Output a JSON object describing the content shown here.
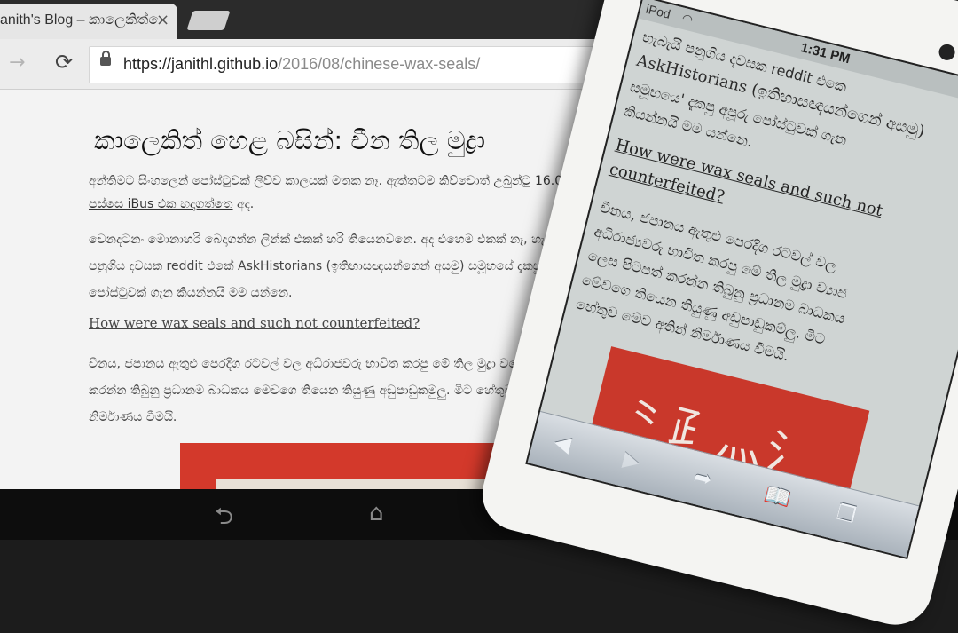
{
  "browser": {
    "tab_title": "anith's Blog – කාලෙකිත් ෙ",
    "tab_close": "×",
    "url_host": "https://janithl.github.io",
    "url_path": "/2016/08/chinese-wax-seals/",
    "forward_glyph": "→",
    "reload_glyph": "⟳"
  },
  "article": {
    "title": "කාලෙකිත් හෙළ බසින්: චීන තිල මුද්‍රා",
    "para1_line1_text": "අන්තිමට සිංහලෙන් පෝස්ටුවක් ලිව්ව කාලයක් මතක නෑ. ඇත්තටම කිව්වොත් ",
    "para1_line1_link": "උබුන්ටු 16.04 ද",
    "para1_line2_link": "පස්සෙ iBus එක හදාගත්තෙ",
    "para1_line2_text": " අද.",
    "para2_line1": "වෙනදටනං මොනාහරි බෙදාගන්න ලින්ක් එකක් හරි තියෙනවනෙ. අද එහෙම එකක් නෑ, හැ",
    "para2_line2": "පනුගිය දවසක reddit එකේ AskHistorians (ඉතිහාසඥයන්ගෙන් අසමු) සමූහයේ දැකපු",
    "para2_line3": "පෝස්ටුවක් ගැන කියන්නයි මම යන්නෙ.",
    "heading": "How were wax seals and such not counterfeited?",
    "para3_line1": "චීනය, ජපානය ඇතුළු පෙරදිග රටවල් වල අධිරාජවරු භාවිත කරපු මේ තිල මුද්‍රා වගෙ",
    "para3_line2": "කරන්න තිබුනු ප්‍රධානම බාධකය මෙවගෙ තියෙන තියුණු අඩුපාඩුකමුලු. මිට හේතුව මේ",
    "para3_line3": "නිර්මාණය වීමයි."
  },
  "android_nav": {
    "back": "⮌",
    "home": "⌂",
    "recents": "▭"
  },
  "ipod": {
    "carrier": "iPod",
    "time": "1:31 PM",
    "line1": "හැබැයි පනුගිය දවසක reddit එකෙ",
    "line2": "AskHistorians (ඉතිහාසඥයන්ගෙන් අසමු)",
    "line3": "සමූහයෙ' දැකපු අපූරු පෝස්ටුවක් ගැන",
    "line4": "කියන්නයි මම යන්නෙ.",
    "link1": "How were wax seals and such not",
    "link2": "counterfeited?",
    "line5": "චීනය, ජපානය ඇතුළු පෙරදිග රටවල් වල",
    "line6": "අධිරාජ්‍යවරු භාවිත කරපු මේ තිල මුද්‍රා ව්‍යාජ",
    "line7": "ලෙස පිටපත් කරන්න තිබුනු ප්‍රධානම බාධකය",
    "line8": "මේවගෙ තියෙන තියුණු අඩුපාඩුකම්ලු. මිට",
    "line9": "හේතුව මේව අතින් නිර්මාණය වීමයි.",
    "seal_glyphs": "⺀⺪⺣⺡",
    "back_btn": "◀",
    "forward_btn": "▶",
    "share_btn": "➦",
    "bookmarks_btn": "📖",
    "tabs_btn": "❐"
  }
}
